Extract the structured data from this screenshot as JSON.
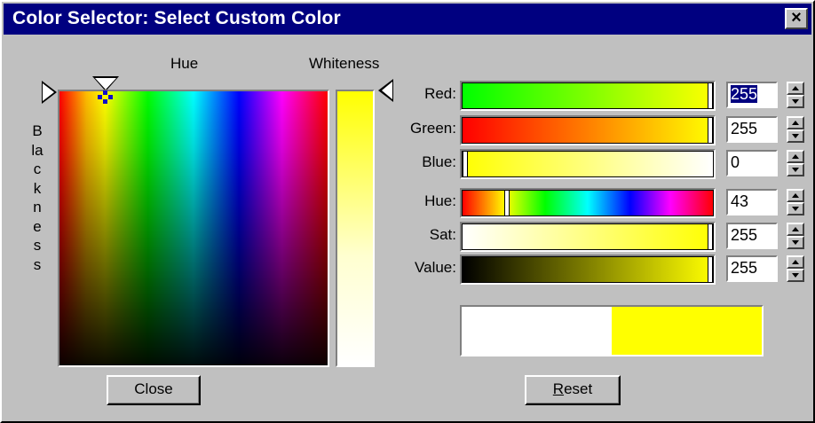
{
  "window": {
    "title": "Color Selector: Select Custom Color",
    "close_glyph": "×"
  },
  "picker": {
    "hue_label": "Hue",
    "whiteness_label": "Whiteness",
    "blackness_label": "Blackness"
  },
  "sliders": [
    {
      "label": "Red:",
      "value": "255",
      "fraction": 1.0,
      "gradient": "linear-gradient(to right, #00ff00, #ffff00)"
    },
    {
      "label": "Green:",
      "value": "255",
      "fraction": 1.0,
      "gradient": "linear-gradient(to right, #ff0000, #ffff00)"
    },
    {
      "label": "Blue:",
      "value": "0",
      "fraction": 0.0,
      "gradient": "linear-gradient(to right, #ffff00, #ffffff)"
    },
    {
      "label": "Hue:",
      "value": "43",
      "fraction": 0.17,
      "gradient": "linear-gradient(to right, #ff0000, #ffff00 17%, #00ff00 33%, #00ffff 50%, #0000ff 67%, #ff00ff 83%, #ff0000)"
    },
    {
      "label": "Sat:",
      "value": "255",
      "fraction": 1.0,
      "gradient": "linear-gradient(to right, #ffffff, #ffff00)"
    },
    {
      "label": "Value:",
      "value": "255",
      "fraction": 1.0,
      "gradient": "linear-gradient(to right, #000000, #ffff00)"
    }
  ],
  "preview": {
    "old_color": "#ffffff",
    "new_color": "#ffff00"
  },
  "buttons": {
    "close": "Close",
    "reset_mnemonic": "R",
    "reset_rest": "eset"
  },
  "icons": {
    "spin_up": "up-arrow-icon",
    "spin_down": "down-arrow-icon"
  }
}
